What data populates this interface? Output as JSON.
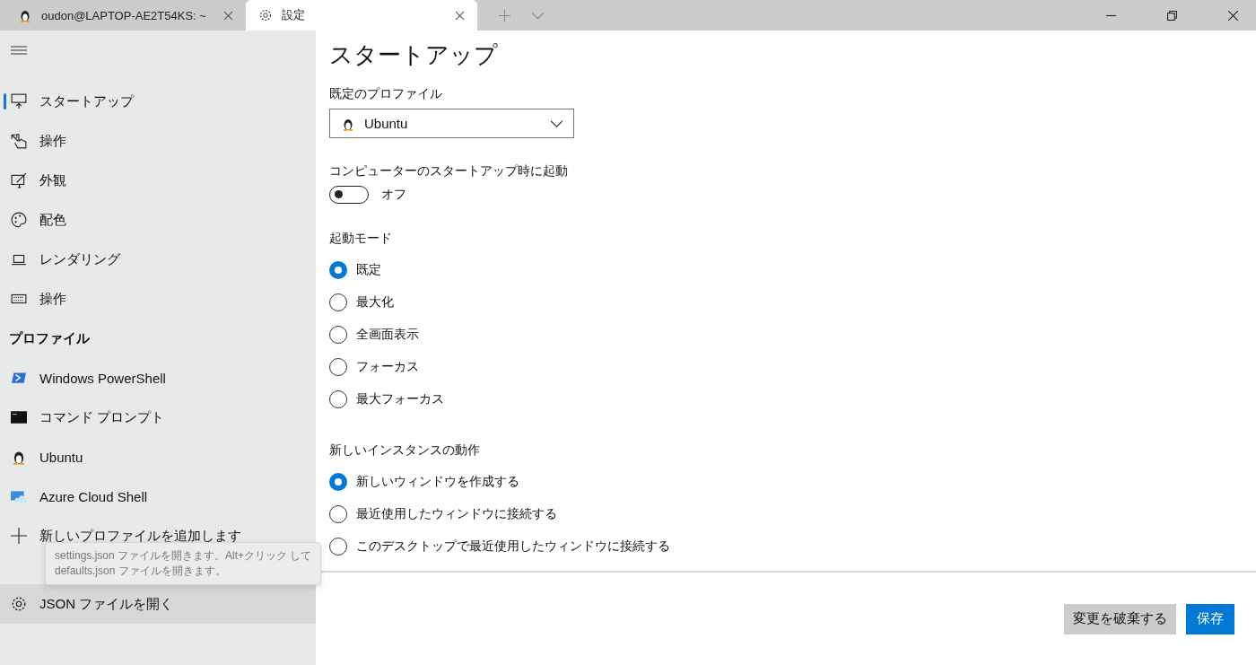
{
  "tabs": [
    {
      "label": "oudon@LAPTOP-AE2T54KS: ~",
      "kind": "penguin",
      "selected": false
    },
    {
      "label": "設定",
      "kind": "gear",
      "selected": true
    }
  ],
  "sidebar": {
    "items": [
      {
        "label": "スタートアップ",
        "kind": "startup",
        "selected": true
      },
      {
        "label": "操作",
        "kind": "hand",
        "selected": false
      },
      {
        "label": "外観",
        "kind": "appearance",
        "selected": false
      },
      {
        "label": "配色",
        "kind": "palette",
        "selected": false
      },
      {
        "label": "レンダリング",
        "kind": "laptop",
        "selected": false
      },
      {
        "label": "操作",
        "kind": "keyboard",
        "selected": false
      }
    ],
    "section_title": "プロファイル",
    "profiles": [
      {
        "label": "Windows PowerShell",
        "kind": "powershell",
        "selected": false
      },
      {
        "label": "コマンド プロンプト",
        "kind": "cmd",
        "selected": false
      },
      {
        "label": "Ubuntu",
        "kind": "penguin",
        "selected": false
      },
      {
        "label": "Azure Cloud Shell",
        "kind": "azure",
        "selected": false
      }
    ],
    "add_profile": "新しいプロファイルを追加します",
    "tooltip": {
      "lines": [
        "settings.json ファイルを開きます。Alt+クリック して",
        "defaults.json ファイルを開きます。"
      ]
    },
    "open_json": {
      "label": "JSON ファイルを開く",
      "hovered": true
    }
  },
  "content": {
    "title": "スタートアップ",
    "default_profile": {
      "label": "既定のプロファイル",
      "value": "Ubuntu"
    },
    "launch_on_startup": {
      "label": "コンピューターのスタートアップ時に起動",
      "on": false,
      "state_text": "オフ"
    },
    "launch_mode": {
      "label": "起動モード",
      "options": [
        {
          "label": "既定",
          "selected": true
        },
        {
          "label": "最大化",
          "selected": false
        },
        {
          "label": "全画面表示",
          "selected": false
        },
        {
          "label": "フォーカス",
          "selected": false
        },
        {
          "label": "最大フォーカス",
          "selected": false
        }
      ]
    },
    "new_instance": {
      "label": "新しいインスタンスの動作",
      "options": [
        {
          "label": "新しいウィンドウを作成する",
          "selected": true
        },
        {
          "label": "最近使用したウィンドウに接続する",
          "selected": false
        },
        {
          "label": "このデスクトップで最近使用したウィンドウに接続する",
          "selected": false
        }
      ]
    }
  },
  "buttons": [
    {
      "label": "変更を破棄する",
      "kind": "secondary"
    },
    {
      "label": "保存",
      "kind": "primary"
    }
  ]
}
